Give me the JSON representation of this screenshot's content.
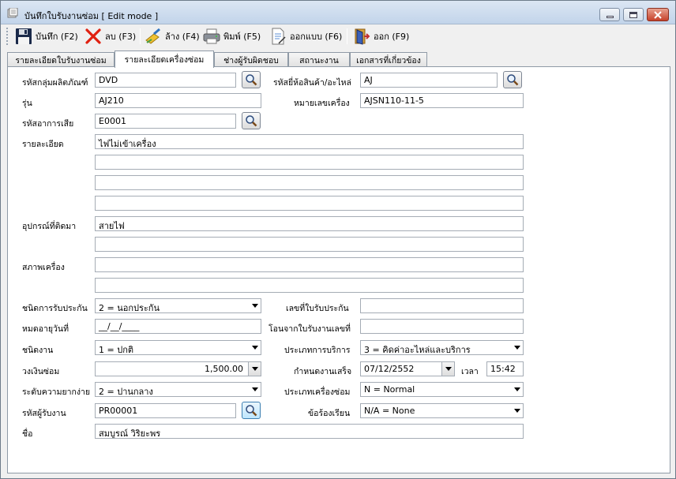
{
  "window": {
    "title": "บันทึกใบรับงานซ่อม [ Edit mode ]"
  },
  "toolbar": {
    "save": "บันทึก (F2)",
    "delete": "ลบ (F3)",
    "clear": "ล้าง (F4)",
    "print": "พิมพ์ (F5)",
    "design": "ออกแบบ (F6)",
    "exit": "ออก (F9)"
  },
  "tabs": [
    "รายละเอียดใบรับงานซ่อม",
    "รายละเอียดเครื่องซ่อม",
    "ช่างผู้รับผิดชอบ",
    "สถานะงาน",
    "เอกสารที่เกี่ยวข้อง"
  ],
  "form": {
    "product_group": {
      "label": "รหัสกลุ่มผลิตภัณฑ์",
      "value": "DVD"
    },
    "brand_code": {
      "label": "รหัสยี่ห้อสินค้า/อะไหล่",
      "value": "AJ"
    },
    "model": {
      "label": "รุ่น",
      "value": "AJ210"
    },
    "serial_no": {
      "label": "หมายเลขเครื่อง",
      "value": "AJSN110-11-5"
    },
    "symptom_code": {
      "label": "รหัสอาการเสีย",
      "value": "E0001"
    },
    "details": {
      "label": "รายละเอียด",
      "lines": [
        "ไฟไม่เข้าเครื่อง",
        "",
        "",
        ""
      ]
    },
    "accessories": {
      "label": "อุปกรณ์ที่ติดมา",
      "lines": [
        "สายไฟ",
        ""
      ]
    },
    "condition": {
      "label": "สภาพเครื่อง",
      "lines": [
        "",
        ""
      ]
    },
    "warranty_type": {
      "label": "ชนิดการรับประกัน",
      "value": "2 = นอกประกัน"
    },
    "warranty_no": {
      "label": "เลขที่ใบรับประกัน",
      "value": ""
    },
    "warranty_expiry": {
      "label": "หมดอายุวันที่",
      "value": "__/__/____"
    },
    "transfer_from": {
      "label": "โอนจากใบรับงานเลขที่",
      "value": ""
    },
    "job_type": {
      "label": "ชนิดงาน",
      "value": "1 = ปกติ"
    },
    "service_type": {
      "label": "ประเภทการบริการ",
      "value": "3 = คิดค่าอะไหล่และบริการ"
    },
    "repair_budget": {
      "label": "วงเงินซ่อม",
      "value": "1,500.00"
    },
    "due_date": {
      "label": "กำหนดงานเสร็จ",
      "value": "07/12/2552"
    },
    "due_time": {
      "label": "เวลา",
      "value": "15:42"
    },
    "difficulty": {
      "label": "ระดับความยากง่าย",
      "value": "2 = ปานกลาง"
    },
    "repair_machine_type": {
      "label": "ประเภทเครื่องซ่อม",
      "value": "N = Normal"
    },
    "receiver_code": {
      "label": "รหัสผู้รับงาน",
      "value": "PR00001"
    },
    "complaint": {
      "label": "ข้อร้องเรียน",
      "value": "N/A = None"
    },
    "name": {
      "label": "ชื่อ",
      "value": "สมบูรณ์ วิริยะพร"
    }
  }
}
